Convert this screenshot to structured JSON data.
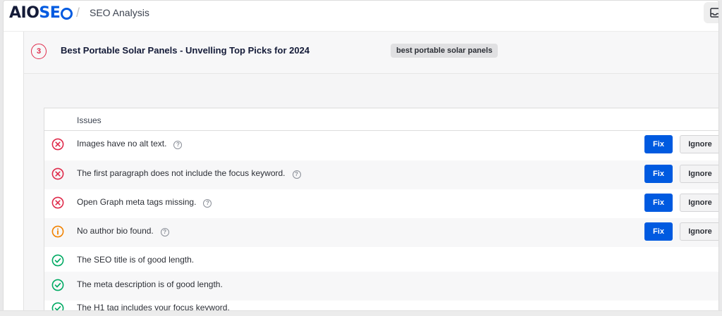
{
  "header": {
    "logo_prefix": "AIO",
    "logo_suffix": "SE",
    "page_title": "SEO Analysis",
    "separator": "/"
  },
  "post": {
    "score": "3",
    "title": "Best Portable Solar Panels - Unvelling Top Picks for 2024",
    "keyword": "best portable solar panels"
  },
  "issues": {
    "header": "Issues",
    "fix_label": "Fix",
    "ignore_label": "Ignore",
    "help_glyph": "?",
    "rows": [
      {
        "text": "Images have no alt text.",
        "status": "error"
      },
      {
        "text": "The first paragraph does not include the focus keyword.",
        "status": "error"
      },
      {
        "text": "Open Graph meta tags missing.",
        "status": "error"
      },
      {
        "text": "No author bio found.",
        "status": "warning"
      },
      {
        "text": "The SEO title is of good length.",
        "status": "pass"
      },
      {
        "text": "The meta description is of good length.",
        "status": "pass"
      },
      {
        "text": "The H1 tag includes your focus keyword.",
        "status": "pass"
      }
    ]
  },
  "colors": {
    "brand_dark": "#141b38",
    "brand_blue": "#005ae0",
    "error": "#df2a4a",
    "warning": "#f18200",
    "pass": "#00aa63"
  }
}
